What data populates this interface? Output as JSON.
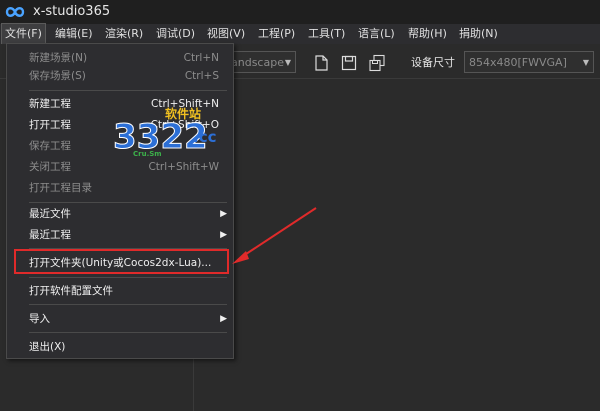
{
  "app": {
    "title": "x-studio365"
  },
  "menubar": {
    "items": [
      {
        "label": "文件(F)"
      },
      {
        "label": "编辑(E)"
      },
      {
        "label": "渲染(R)"
      },
      {
        "label": "调试(D)"
      },
      {
        "label": "视图(V)"
      },
      {
        "label": "工程(P)"
      },
      {
        "label": "工具(T)"
      },
      {
        "label": "语言(L)"
      },
      {
        "label": "帮助(H)"
      },
      {
        "label": "捐助(N)"
      }
    ]
  },
  "toolbar": {
    "orientation_value": "andscape",
    "device_size_label": "设备尺寸",
    "device_size_value": "854x480[FWVGA]"
  },
  "file_menu": {
    "items": [
      {
        "label": "新建场景(N)",
        "shortcut": "Ctrl+N",
        "disabled": true
      },
      {
        "label": "保存场景(S)",
        "shortcut": "Ctrl+S",
        "disabled": true
      },
      {
        "label": "新建工程",
        "shortcut": "Ctrl+Shift+N",
        "disabled": false
      },
      {
        "label": "打开工程",
        "shortcut": "Ctrl+Shift+O",
        "disabled": false
      },
      {
        "label": "保存工程",
        "shortcut": "",
        "disabled": true
      },
      {
        "label": "关闭工程",
        "shortcut": "Ctrl+Shift+W",
        "disabled": true
      },
      {
        "label": "打开工程目录",
        "shortcut": "",
        "disabled": true
      },
      {
        "label": "最近文件",
        "shortcut": "",
        "disabled": false,
        "submenu": true
      },
      {
        "label": "最近工程",
        "shortcut": "",
        "disabled": false,
        "submenu": true
      },
      {
        "label": "打开文件夹(Unity或Cocos2dx-Lua)...",
        "shortcut": "",
        "disabled": false
      },
      {
        "label": "打开软件配置文件",
        "shortcut": "",
        "disabled": false
      },
      {
        "label": "导入",
        "shortcut": "",
        "disabled": false,
        "submenu": true
      },
      {
        "label": "退出(X)",
        "shortcut": "",
        "disabled": false
      }
    ]
  },
  "watermark": {
    "number": "3322",
    "domain": ".cc",
    "site": "软件站",
    "sub": "Cru.Sm"
  }
}
